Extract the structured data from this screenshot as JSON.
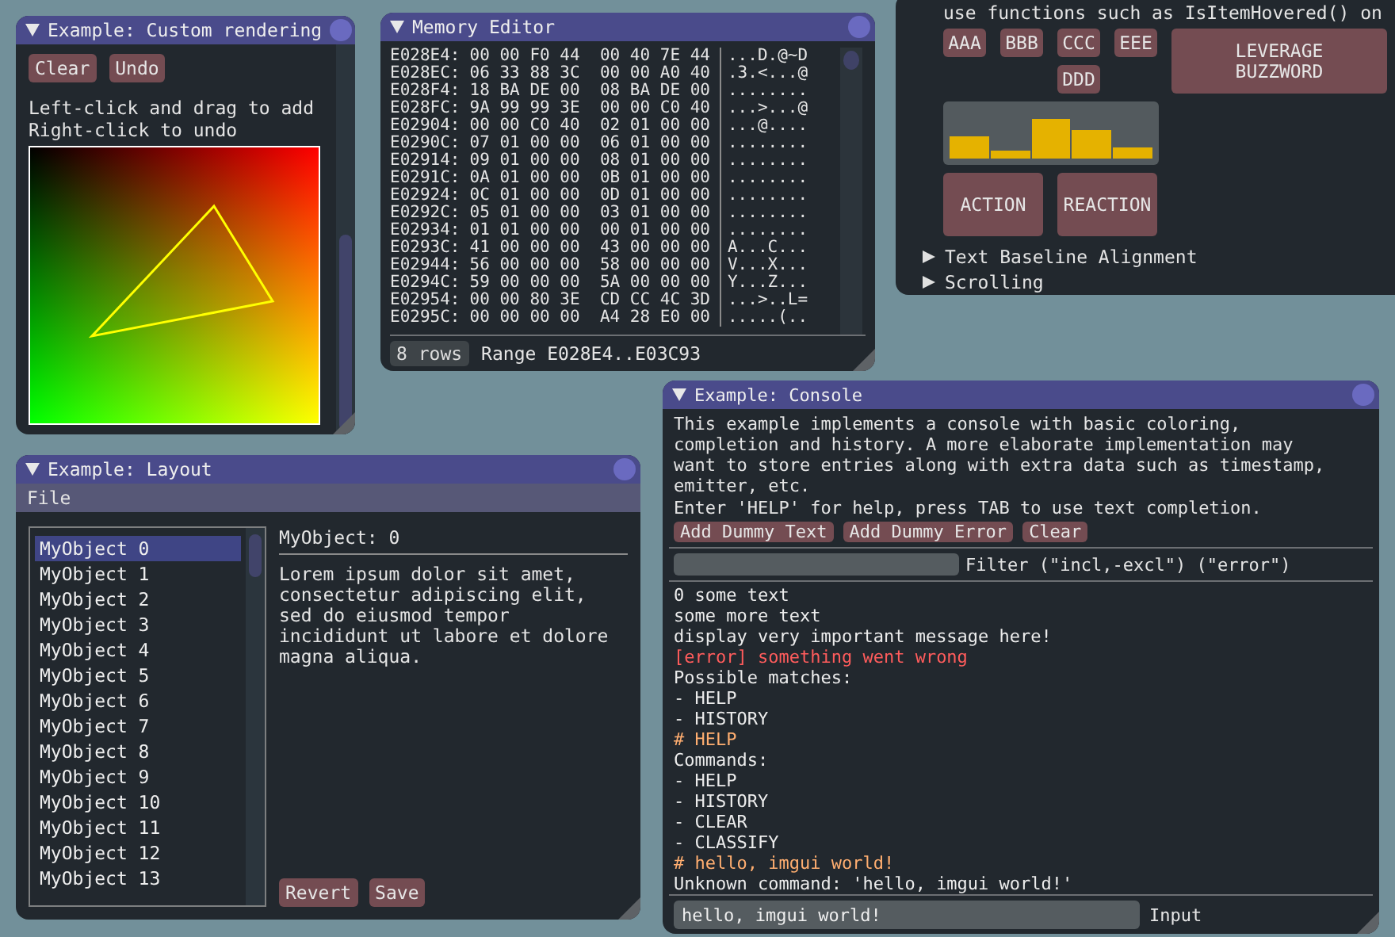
{
  "custom_rendering": {
    "title": "Example: Custom rendering",
    "buttons": [
      "Clear",
      "Undo"
    ],
    "help": [
      "Left-click and drag to add",
      "Right-click to undo"
    ]
  },
  "memory_editor": {
    "title": "Memory Editor",
    "rows": [
      {
        "address": "E028E4:",
        "bytes": "00 00 F0 44  00 40 7E 44",
        "ascii": "...D.@~D"
      },
      {
        "address": "E028EC:",
        "bytes": "06 33 88 3C  00 00 A0 40",
        "ascii": ".3.<...@"
      },
      {
        "address": "E028F4:",
        "bytes": "18 BA DE 00  08 BA DE 00",
        "ascii": "........"
      },
      {
        "address": "E028FC:",
        "bytes": "9A 99 99 3E  00 00 C0 40",
        "ascii": "...>...@"
      },
      {
        "address": "E02904:",
        "bytes": "00 00 C0 40  02 01 00 00",
        "ascii": "...@...."
      },
      {
        "address": "E0290C:",
        "bytes": "07 01 00 00  06 01 00 00",
        "ascii": "........"
      },
      {
        "address": "E02914:",
        "bytes": "09 01 00 00  08 01 00 00",
        "ascii": "........"
      },
      {
        "address": "E0291C:",
        "bytes": "0A 01 00 00  0B 01 00 00",
        "ascii": "........"
      },
      {
        "address": "E02924:",
        "bytes": "0C 01 00 00  0D 01 00 00",
        "ascii": "........"
      },
      {
        "address": "E0292C:",
        "bytes": "05 01 00 00  03 01 00 00",
        "ascii": "........"
      },
      {
        "address": "E02934:",
        "bytes": "01 01 00 00  00 01 00 00",
        "ascii": "........"
      },
      {
        "address": "E0293C:",
        "bytes": "41 00 00 00  43 00 00 00",
        "ascii": "A...C..."
      },
      {
        "address": "E02944:",
        "bytes": "56 00 00 00  58 00 00 00",
        "ascii": "V...X..."
      },
      {
        "address": "E0294C:",
        "bytes": "59 00 00 00  5A 00 00 00",
        "ascii": "Y...Z..."
      },
      {
        "address": "E02954:",
        "bytes": "00 00 80 3E  CD CC 4C 3D",
        "ascii": "...>..L="
      },
      {
        "address": "E0295C:",
        "bytes": "00 00 00 00  A4 28 E0 00",
        "ascii": ".....(.."
      }
    ],
    "rows_button": "8 rows",
    "range": "Range E028E4..E03C93"
  },
  "widgets": {
    "text": "use functions such as IsItemHovered() on",
    "small_buttons": [
      "AAA",
      "BBB",
      "CCC",
      "EEE",
      "DDD"
    ],
    "big_button": "LEVERAGE BUZZWORD",
    "action_buttons": [
      "ACTION",
      "REACTION"
    ],
    "tree_nodes": [
      {
        "label": "Text Baseline Alignment",
        "expanded": false
      },
      {
        "label": "Scrolling",
        "expanded": false
      }
    ]
  },
  "layout": {
    "title": "Example: Layout",
    "menu": [
      "File"
    ],
    "items": [
      {
        "label": "MyObject 0",
        "selected": true
      },
      {
        "label": "MyObject 1",
        "selected": false
      },
      {
        "label": "MyObject 2",
        "selected": false
      },
      {
        "label": "MyObject 3",
        "selected": false
      },
      {
        "label": "MyObject 4",
        "selected": false
      },
      {
        "label": "MyObject 5",
        "selected": false
      },
      {
        "label": "MyObject 6",
        "selected": false
      },
      {
        "label": "MyObject 7",
        "selected": false
      },
      {
        "label": "MyObject 8",
        "selected": false
      },
      {
        "label": "MyObject 9",
        "selected": false
      },
      {
        "label": "MyObject 10",
        "selected": false
      },
      {
        "label": "MyObject 11",
        "selected": false
      },
      {
        "label": "MyObject 12",
        "selected": false
      },
      {
        "label": "MyObject 13",
        "selected": false
      }
    ],
    "detail_title": "MyObject: 0",
    "detail_text": "Lorem ipsum dolor sit amet, consectetur adipiscing elit, sed do eiusmod tempor incididunt ut labore et dolore magna aliqua.",
    "buttons": [
      "Revert",
      "Save"
    ]
  },
  "console": {
    "title": "Example: Console",
    "description": [
      "This example implements a console with basic coloring,",
      "completion and history. A more elaborate implementation may",
      "want to store entries along with extra data such as timestamp,",
      "emitter, etc."
    ],
    "hint": "Enter 'HELP' for help, press TAB to use text completion.",
    "buttons": [
      "Add Dummy Text",
      "Add Dummy Error",
      "Clear"
    ],
    "filter_label": "Filter (\"incl,-excl\") (\"error\")",
    "log": [
      {
        "text": "0 some text",
        "kind": "output"
      },
      {
        "text": "some more text",
        "kind": "output"
      },
      {
        "text": "display very important message here!",
        "kind": "output"
      },
      {
        "text": "[error] something went wrong",
        "kind": "error"
      },
      {
        "text": "Possible matches:",
        "kind": "output"
      },
      {
        "text": "- HELP",
        "kind": "output"
      },
      {
        "text": "- HISTORY",
        "kind": "output"
      },
      {
        "text": "# HELP",
        "kind": "command"
      },
      {
        "text": "Commands:",
        "kind": "output"
      },
      {
        "text": "- HELP",
        "kind": "output"
      },
      {
        "text": "- HISTORY",
        "kind": "output"
      },
      {
        "text": "- CLEAR",
        "kind": "output"
      },
      {
        "text": "- CLASSIFY",
        "kind": "output"
      },
      {
        "text": "# hello, imgui world!",
        "kind": "command"
      },
      {
        "text": "Unknown command: 'hello, imgui world!'",
        "kind": "output"
      }
    ],
    "input": {
      "value": "hello, imgui world!",
      "label": "Input"
    }
  }
}
